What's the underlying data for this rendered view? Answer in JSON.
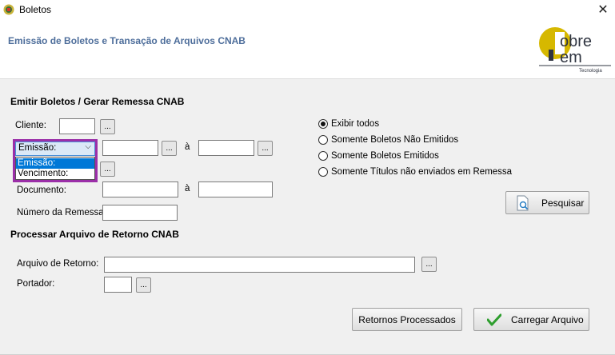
{
  "window": {
    "title": "Boletos",
    "close_icon": "close-icon"
  },
  "header": {
    "title": "Emissão de Boletos e Transação de Arquivos CNAB",
    "logo_text": {
      "line1": "obre",
      "line2": "em",
      "tagline": "Tecnologia"
    },
    "brand_colors": {
      "yellow": "#d6b800",
      "gray": "#2f3440"
    }
  },
  "emitir": {
    "section_title": "Emitir Boletos / Gerar Remessa CNAB",
    "cliente_label": "Cliente:",
    "cliente_value": "",
    "date_type_select": {
      "selected": "Emissão:",
      "options": [
        "Emissão:",
        "Vencimento:"
      ]
    },
    "date_from": "",
    "date_to": "",
    "range_sep": "à",
    "documento_label": "Documento:",
    "documento_from": "",
    "documento_to": "",
    "numero_remessa_label": "Número da Remessa:",
    "numero_remessa_value": "",
    "ellipsis": "..."
  },
  "filters": {
    "options": [
      "Exibir todos",
      "Somente Boletos Não Emitidos",
      "Somente Boletos Emitidos",
      "Somente Títulos não enviados em Remessa"
    ],
    "selected_index": 0
  },
  "pesquisar_button": "Pesquisar",
  "retorno": {
    "section_title": "Processar Arquivo de Retorno CNAB",
    "arquivo_label": "Arquivo de Retorno:",
    "arquivo_value": "",
    "portador_label": "Portador:",
    "portador_value": ""
  },
  "buttons": {
    "retornos_processados": "Retornos Processados",
    "carregar_arquivo": "Carregar Arquivo"
  },
  "colors": {
    "accent_header": "#4e6e9b",
    "dropdown_highlight": "#0078d7",
    "focus_frame": "#9b2fa8"
  }
}
